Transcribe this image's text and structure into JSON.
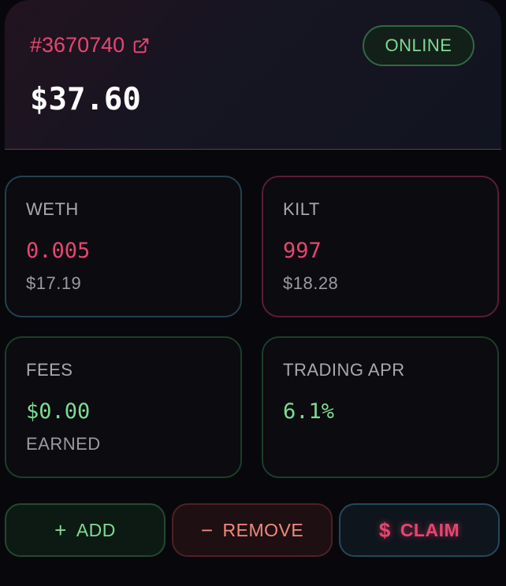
{
  "position": {
    "id": "#3670740",
    "link_icon": "external-link-icon",
    "status": "ONLINE",
    "total_value": "$37.60"
  },
  "cards": {
    "weth": {
      "label": "WETH",
      "amount": "0.005",
      "usd": "$17.19"
    },
    "kilt": {
      "label": "KILT",
      "amount": "997",
      "usd": "$18.28"
    },
    "fees": {
      "label": "FEES",
      "amount": "$0.00",
      "sub": "EARNED"
    },
    "apr": {
      "label": "TRADING APR",
      "amount": "6.1%"
    }
  },
  "actions": {
    "add": {
      "icon": "+",
      "label": "ADD"
    },
    "remove": {
      "icon": "−",
      "label": "REMOVE"
    },
    "claim": {
      "icon": "$",
      "label": "CLAIM"
    }
  },
  "colors": {
    "accent_pink": "#e8456f",
    "accent_green": "#7edb91",
    "background": "#08080c"
  }
}
